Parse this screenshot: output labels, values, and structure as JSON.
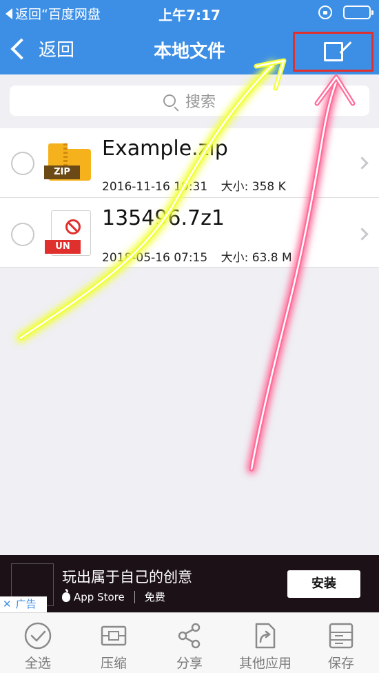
{
  "status_bar": {
    "back_app": "返回“百度网盘",
    "time": "上午7:17"
  },
  "nav": {
    "back_label": "返回",
    "title": "本地文件"
  },
  "search": {
    "placeholder": "搜索"
  },
  "files": [
    {
      "name": "Example.zip",
      "date": "2016-11-16 19:31",
      "size_label": "大小:",
      "size": "358 K",
      "icon": "zip-file-icon",
      "badge": "ZIP"
    },
    {
      "name": "135496.7z1",
      "date": "2018-05-16 07:15",
      "size_label": "大小:",
      "size": "63.8 M",
      "icon": "unsupported-file-icon",
      "badge": "UN"
    }
  ],
  "ad": {
    "title": "玩出属于自己的创意",
    "store": "App Store",
    "price": "免费",
    "install": "安装",
    "tag": "广告"
  },
  "toolbar": {
    "select_all": "全选",
    "compress": "压缩",
    "share": "分享",
    "other_apps": "其他应用",
    "save": "保存"
  },
  "colors": {
    "header_blue": "#3d8fe6",
    "highlight_red": "#e0302d",
    "zip_yellow": "#f6b21c",
    "arrow_yellow": "#f2ff3c",
    "arrow_pink": "#ff6d9a"
  }
}
